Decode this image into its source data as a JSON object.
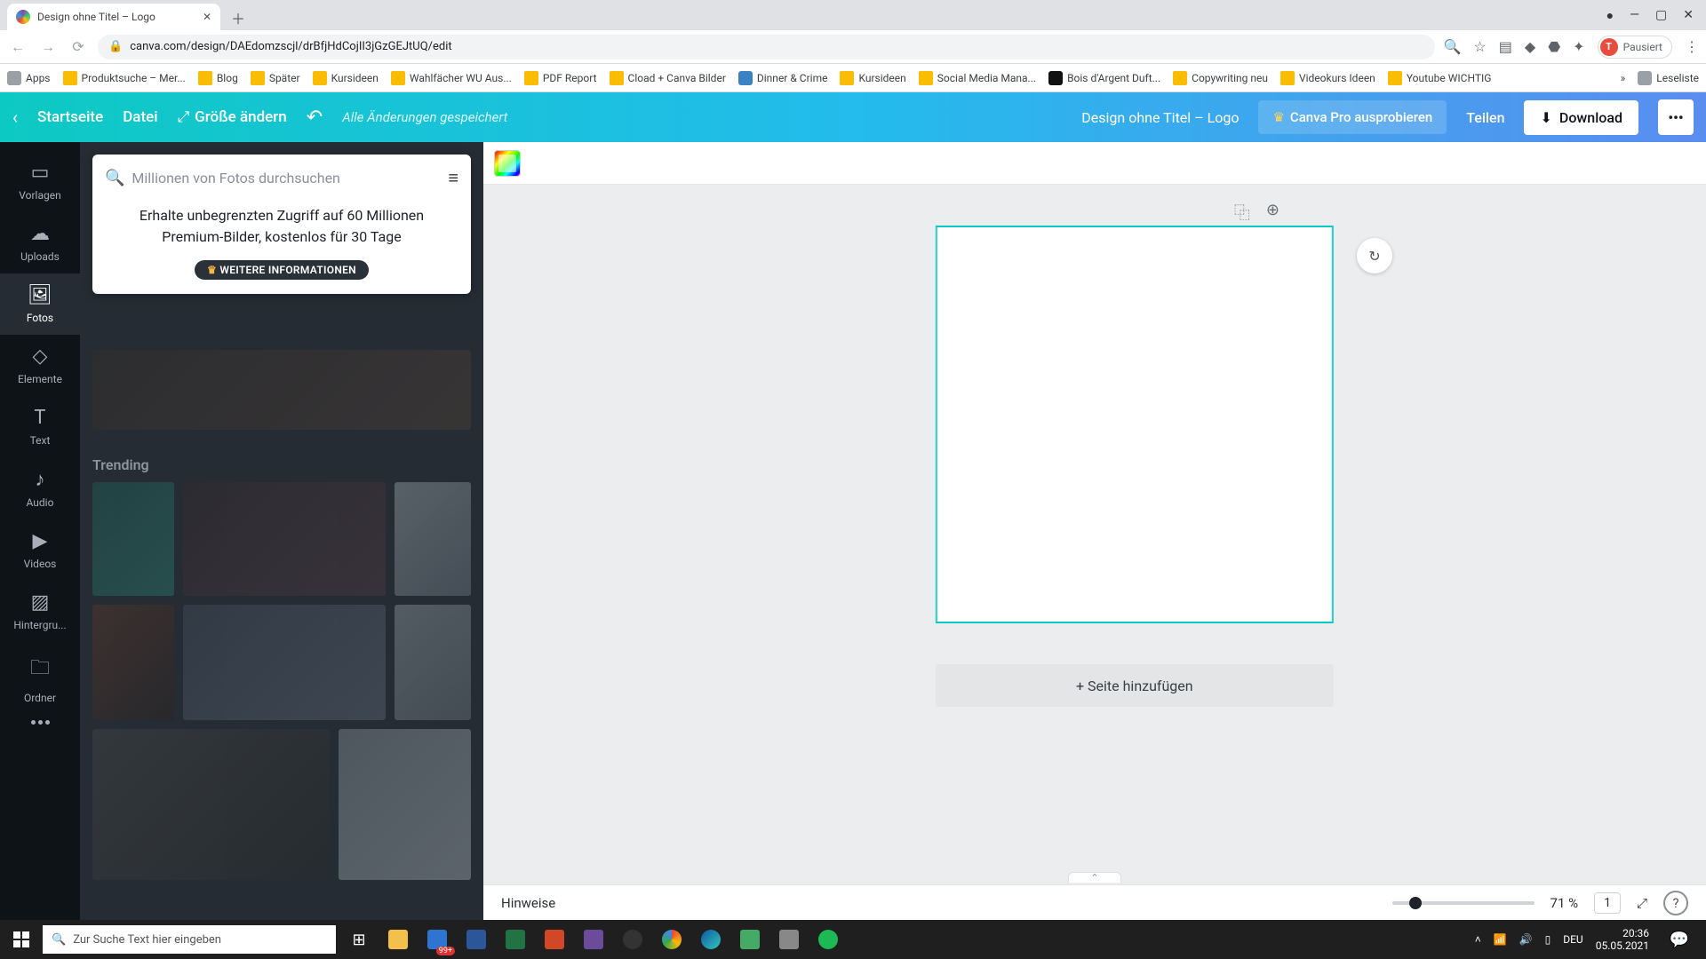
{
  "browser": {
    "tab_title": "Design ohne Titel – Logo",
    "url": "canva.com/design/DAEdomzscjl/drBfjHdCojII3jGzGEJtUQ/edit",
    "profile_status": "Pausiert",
    "profile_initial": "T",
    "bookmarks": [
      "Apps",
      "Produktsuche – Mer...",
      "Blog",
      "Später",
      "Kursideen",
      "Wahlfächer WU Aus...",
      "PDF Report",
      "Cload + Canva Bilder",
      "Dinner & Crime",
      "Kursideen",
      "Social Media Mana...",
      "Bois d'Argent Duft...",
      "Copywriting neu",
      "Videokurs Ideen",
      "Youtube WICHTIG"
    ],
    "readlist": "Leseliste"
  },
  "canva_bar": {
    "home": "Startseite",
    "file": "Datei",
    "resize": "Größe ändern",
    "saved": "Alle Änderungen gespeichert",
    "title": "Design ohne Titel – Logo",
    "try_pro": "Canva Pro ausprobieren",
    "share": "Teilen",
    "download": "Download"
  },
  "sidenav": {
    "items": [
      "Vorlagen",
      "Uploads",
      "Fotos",
      "Elemente",
      "Text",
      "Audio",
      "Videos",
      "Hintergru...",
      "Ordner"
    ],
    "active_index": 2
  },
  "panel": {
    "search_placeholder": "Millionen von Fotos durchsuchen",
    "promo_text": "Erhalte unbegrenzten Zugriff auf 60 Millionen Premium-Bilder, kostenlos für 30 Tage",
    "promo_cta": "WEITERE INFORMATIONEN",
    "section": "Trending"
  },
  "canvas": {
    "add_page": "+ Seite hinzufügen",
    "hints": "Hinweise",
    "zoom_label": "71 %",
    "page_indicator": "1"
  },
  "taskbar": {
    "search_placeholder": "Zur Suche Text hier eingeben",
    "lang": "DEU",
    "time": "20:36",
    "date": "05.05.2021"
  }
}
